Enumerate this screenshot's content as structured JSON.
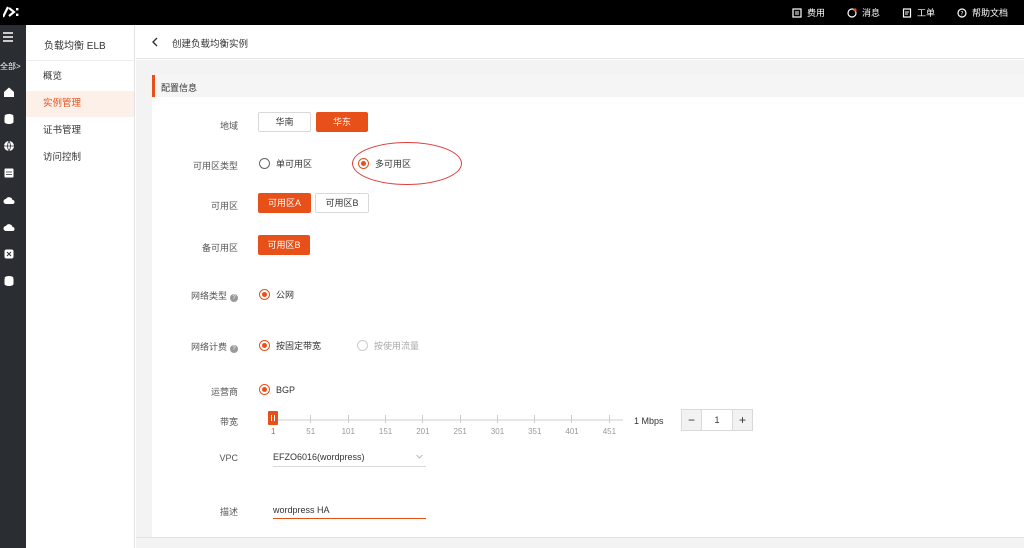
{
  "topbar": {
    "items": [
      {
        "label": "费用",
        "icon": "billing-icon"
      },
      {
        "label": "消息",
        "icon": "message-icon"
      },
      {
        "label": "工单",
        "icon": "ticket-icon"
      },
      {
        "label": "帮助文档",
        "icon": "help-icon"
      }
    ]
  },
  "rail": {
    "all_label": "全部>"
  },
  "sidebar": {
    "title": "负载均衡 ELB",
    "items": [
      {
        "label": "概览",
        "active": false
      },
      {
        "label": "实例管理",
        "active": true
      },
      {
        "label": "证书管理",
        "active": false
      },
      {
        "label": "访问控制",
        "active": false
      }
    ]
  },
  "header": {
    "title": "创建负载均衡实例"
  },
  "section": {
    "title": "配置信息"
  },
  "form": {
    "region": {
      "label": "地域",
      "options": [
        "华南",
        "华东"
      ],
      "selected": "华东"
    },
    "zone_type": {
      "label": "可用区类型",
      "options": [
        "单可用区",
        "多可用区"
      ],
      "selected": "多可用区"
    },
    "zone": {
      "label": "可用区",
      "options": [
        "可用区A",
        "可用区B"
      ],
      "selected": "可用区A"
    },
    "backup_zone": {
      "label": "备可用区",
      "options": [
        "可用区B"
      ],
      "selected": "可用区B"
    },
    "network_type": {
      "label": "网络类型",
      "options": [
        "公网"
      ],
      "selected": "公网"
    },
    "billing": {
      "label": "网络计费",
      "options": [
        "按固定带宽",
        "按使用流量"
      ],
      "selected": "按固定带宽"
    },
    "carrier": {
      "label": "运营商",
      "options": [
        "BGP"
      ],
      "selected": "BGP"
    },
    "bandwidth": {
      "label": "带宽",
      "ticks": [
        "1",
        "51",
        "101",
        "151",
        "201",
        "251",
        "301",
        "351",
        "401",
        "451"
      ],
      "unit": "1 Mbps",
      "value": "1",
      "minus": "−",
      "plus": "+"
    },
    "vpc": {
      "label": "VPC",
      "value": "EFZO6016(wordpress)"
    },
    "description": {
      "label": "描述",
      "value": "wordpress HA"
    }
  },
  "colors": {
    "accent": "#e8501a",
    "annotation": "#e04040"
  }
}
